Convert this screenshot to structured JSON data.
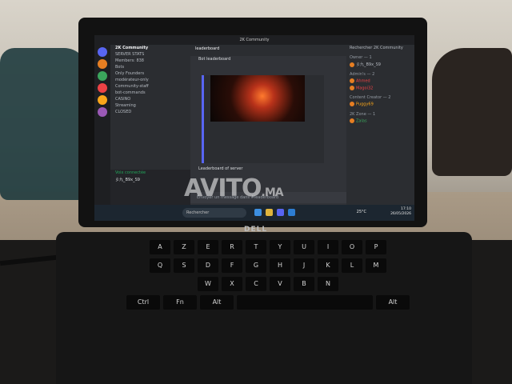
{
  "window": {
    "title": "2K Community"
  },
  "channels": {
    "server": "2K Community",
    "items": [
      "SERVER STATS",
      "Members: 838",
      "Bots",
      "Only Founders",
      "modérateur-only",
      "Community-staff",
      "bot-commands",
      "CASINO",
      "Streaming",
      "CLOSED"
    ]
  },
  "voice": {
    "status": "Voix connectée",
    "user": "彡九_B9x_S9"
  },
  "chat": {
    "channel": "leaderboard",
    "messages": [
      "Bot leaderboard",
      "Leaderboard of server"
    ],
    "composer": "Envoyer un message dans #leaderboard"
  },
  "members": {
    "search": "Rechercher 2K Community",
    "groups": [
      "Owner — 1",
      "Admin's — 2",
      "Content Creator — 2",
      "2K Zone — 1"
    ],
    "names": [
      "彡九_B9x_S9",
      "Ahmed",
      "Magoi32",
      "Puggy69",
      "Zalas"
    ]
  },
  "taskbar": {
    "search": "Rechercher",
    "weather": "25°C",
    "time": "17:10",
    "date": "26/05/2026"
  },
  "brand": {
    "logo": "DELL"
  },
  "keyboard": {
    "row1": [
      "A",
      "Z",
      "E",
      "R",
      "T",
      "Y",
      "U",
      "I",
      "O",
      "P"
    ],
    "row2": [
      "Q",
      "S",
      "D",
      "F",
      "G",
      "H",
      "J",
      "K",
      "L",
      "M"
    ],
    "row3": [
      "W",
      "X",
      "C",
      "V",
      "B",
      "N"
    ],
    "row4": [
      "Ctrl",
      "Fn",
      "Alt",
      "",
      "Alt"
    ]
  },
  "watermark": {
    "text": "AVITO",
    "suffix": ".MA"
  }
}
